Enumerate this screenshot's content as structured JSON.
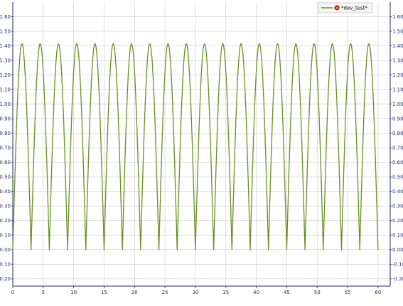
{
  "chart_data": {
    "type": "line",
    "title": "",
    "xlabel": "",
    "ylabel": "",
    "xlim": [
      0,
      62
    ],
    "ylim": [
      -0.25,
      1.7
    ],
    "grid": true,
    "legend_position": "top-right",
    "x_ticks": [
      0,
      5,
      10,
      15,
      20,
      25,
      30,
      35,
      40,
      45,
      50,
      55,
      60
    ],
    "x_tick_labels": [
      "0",
      "5",
      "10",
      "15",
      "20",
      "25",
      "30",
      "35",
      "40",
      "45",
      "50",
      "55",
      "60"
    ],
    "y_ticks": [
      1.6,
      1.5,
      1.4,
      1.3,
      1.2,
      1.1,
      1.0,
      0.9,
      0.8,
      0.7,
      0.6,
      0.5,
      0.4,
      0.3,
      0.2,
      0.1,
      0.0,
      -0.1,
      -0.2
    ],
    "y_tick_labels_left": [
      "1.60",
      "1.50",
      "1.40",
      "1.30",
      "1.20",
      "1.10",
      "1.00",
      "0.90",
      "0.80",
      "0.70",
      "0.60",
      "0.50",
      "0.40",
      "0.30",
      "0.20",
      "0.10",
      "0.00",
      "-0.10",
      "-0.20"
    ],
    "y_tick_labels_right": [
      "1.60",
      "1.50",
      "1.40",
      "1.30",
      "1.20",
      "1.10",
      "1.00",
      "0.90",
      "0.80",
      "0.70",
      "0.60",
      "0.50",
      "0.40",
      "0.30",
      "0.20",
      "0.10",
      "0.00",
      "-0.10",
      "-0.20"
    ],
    "series": [
      {
        "name": "*dev_test*",
        "color": "#6b8e23",
        "form": "abs_sine",
        "amplitude": 1.414,
        "period": 6.0,
        "x_start": 0,
        "x_end": 60,
        "peaks_x": [
          1.5,
          4.5,
          7.5,
          10.5,
          13.5,
          16.5,
          19.5,
          22.5,
          25.5,
          28.5,
          31.5,
          34.5,
          37.5,
          40.5,
          43.5,
          46.5,
          49.5,
          52.5,
          55.5,
          58.5
        ],
        "zeros_x": [
          0,
          3,
          6,
          9,
          12,
          15,
          18,
          21,
          24,
          27,
          30,
          33,
          36,
          39,
          42,
          45,
          48,
          51,
          54,
          57,
          60
        ]
      }
    ]
  },
  "legend": {
    "label": "*dev_test*",
    "icon": "close-circle-icon",
    "icon_color": "#cc2200"
  }
}
